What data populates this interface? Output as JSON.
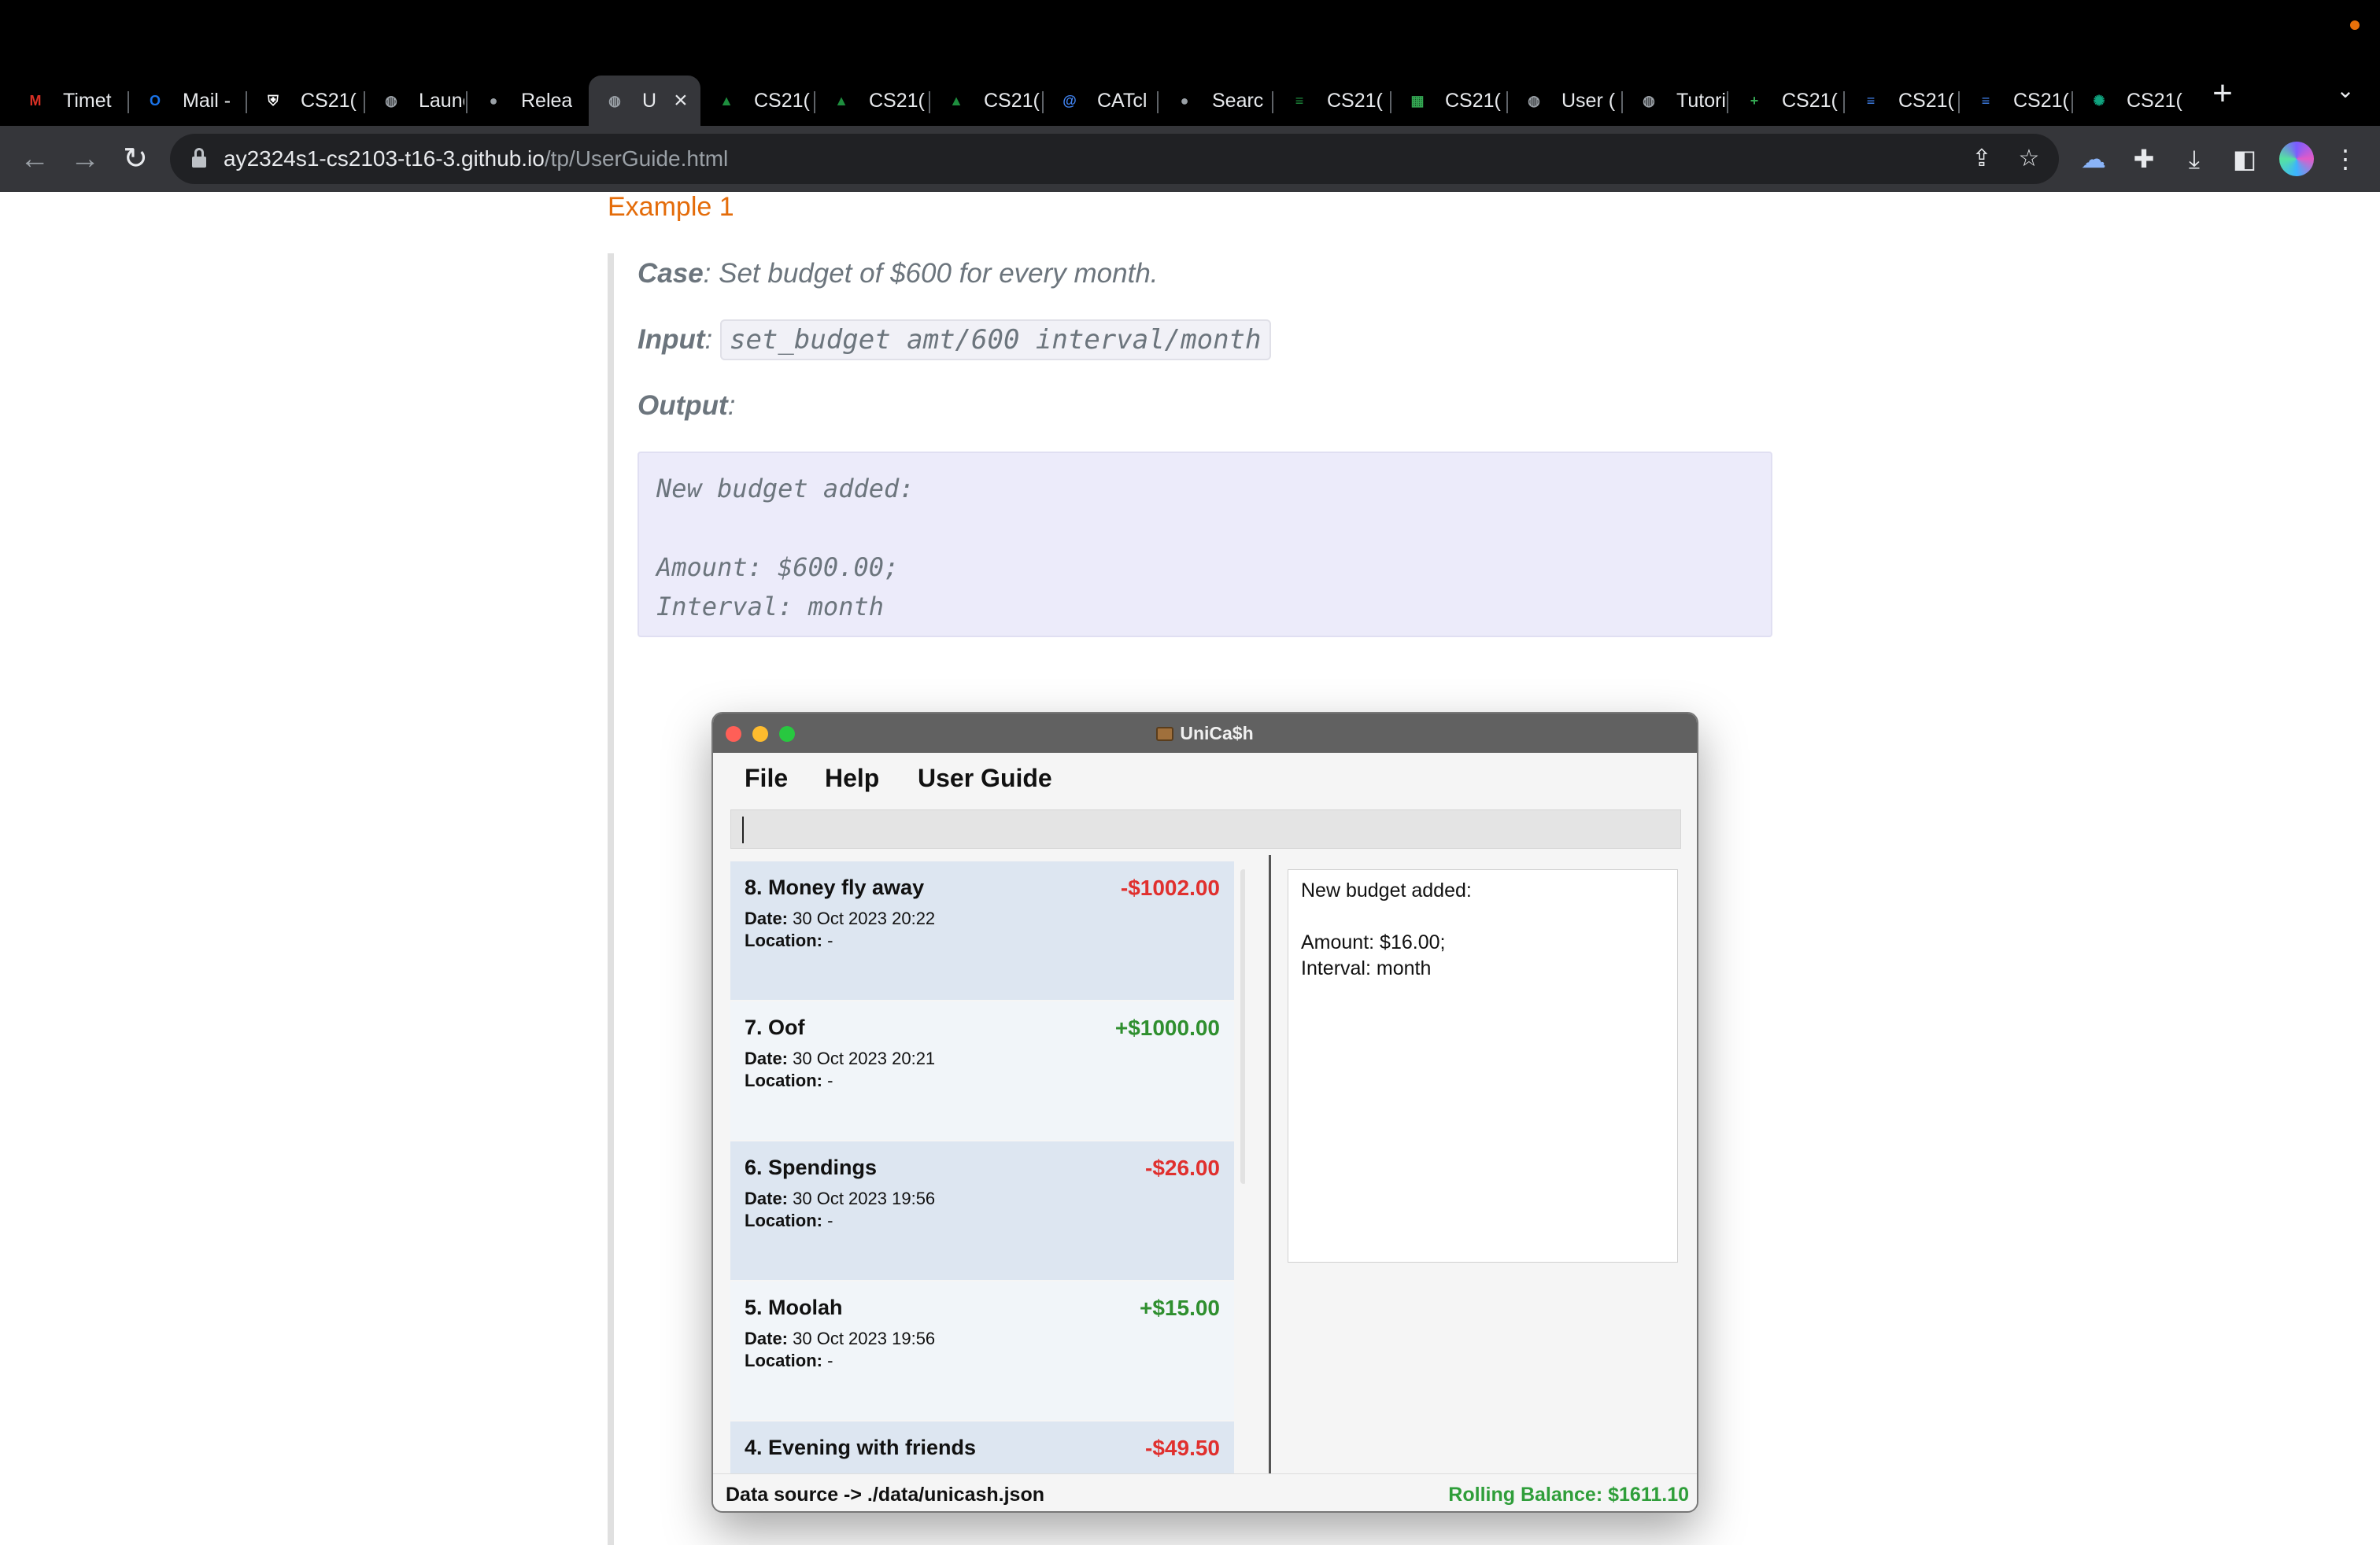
{
  "browser": {
    "tabs": [
      {
        "label": "Timet",
        "icon": "mail-m-icon",
        "color": "#d93025"
      },
      {
        "label": "Mail -",
        "icon": "outlook-icon",
        "color": "#1a73e8"
      },
      {
        "label": "CS21(",
        "icon": "shield-crest-icon",
        "color": "#ffffff"
      },
      {
        "label": "Launc",
        "icon": "globe-icon",
        "color": "#9aa0a6"
      },
      {
        "label": "Relea",
        "icon": "github-icon",
        "color": "#9aa0a6"
      },
      {
        "label": "U",
        "icon": "globe-icon",
        "color": "#9aa0a6"
      },
      {
        "label": "CS21(",
        "icon": "graduation-cap-icon",
        "color": "#1e8e3e"
      },
      {
        "label": "CS21(",
        "icon": "graduation-cap-icon",
        "color": "#1e8e3e"
      },
      {
        "label": "CS21(",
        "icon": "graduation-cap-icon",
        "color": "#1e8e3e"
      },
      {
        "label": "CATcl",
        "icon": "catcher-icon",
        "color": "#4285f4"
      },
      {
        "label": "Searc",
        "icon": "github-icon",
        "color": "#9aa0a6"
      },
      {
        "label": "CS21(",
        "icon": "sheet-list-icon",
        "color": "#1e8e3e"
      },
      {
        "label": "CS21(",
        "icon": "checker-grid-icon",
        "color": "#34a853"
      },
      {
        "label": "User (",
        "icon": "globe-icon",
        "color": "#9aa0a6"
      },
      {
        "label": "Tutori",
        "icon": "globe-icon",
        "color": "#9aa0a6"
      },
      {
        "label": "CS21(",
        "icon": "sheets-plus-icon",
        "color": "#34a853"
      },
      {
        "label": "CS21(",
        "icon": "docs-icon",
        "color": "#4285f4"
      },
      {
        "label": "CS21(",
        "icon": "docs-icon",
        "color": "#4285f4"
      },
      {
        "label": "CS21(",
        "icon": "openai-icon",
        "color": "#10a37f"
      }
    ],
    "url_host": "ay2324s1-cs2103-t16-3.github.io",
    "url_path": "/tp/UserGuide.html"
  },
  "doc": {
    "example_heading": "Example 1",
    "case_key": "Case",
    "case_text": ": Set budget of $600 for every month.",
    "input_key": "Input",
    "input_colon": ": ",
    "input_code": "set_budget amt/600 interval/month",
    "output_key": "Output",
    "output_colon": ":",
    "output_text": "New budget added:\n\nAmount: $600.00;\nInterval: month"
  },
  "app": {
    "title": "UniCa$h",
    "menu": {
      "file": "File",
      "help": "Help",
      "user_guide": "User Guide"
    },
    "command_value": "",
    "transactions": [
      {
        "name": "8. Money fly away",
        "amount": "-$1002.00",
        "sign": "neg",
        "date_label": "Date:",
        "date": "30 Oct 2023 20:22",
        "location_label": "Location:",
        "location": "-"
      },
      {
        "name": "7. Oof",
        "amount": "+$1000.00",
        "sign": "pos",
        "date_label": "Date:",
        "date": "30 Oct 2023 20:21",
        "location_label": "Location:",
        "location": "-"
      },
      {
        "name": "6. Spendings",
        "amount": "-$26.00",
        "sign": "neg",
        "date_label": "Date:",
        "date": "30 Oct 2023 19:56",
        "location_label": "Location:",
        "location": "-"
      },
      {
        "name": "5. Moolah",
        "amount": "+$15.00",
        "sign": "pos",
        "date_label": "Date:",
        "date": "30 Oct 2023 19:56",
        "location_label": "Location:",
        "location": "-"
      },
      {
        "name": "4. Evening with friends",
        "amount": "-$49.50",
        "sign": "neg",
        "date_label": "",
        "date": "",
        "location_label": "",
        "location": ""
      }
    ],
    "result_text": "New budget added:\n\nAmount: $16.00;\nInterval: month",
    "data_source": "Data source -> ./data/unicash.json",
    "rolling_balance": "Rolling Balance: $1611.10",
    "colors": {
      "expense": "#e0302e",
      "income": "#2f8f2f",
      "balance": "#2f9e3a"
    }
  }
}
